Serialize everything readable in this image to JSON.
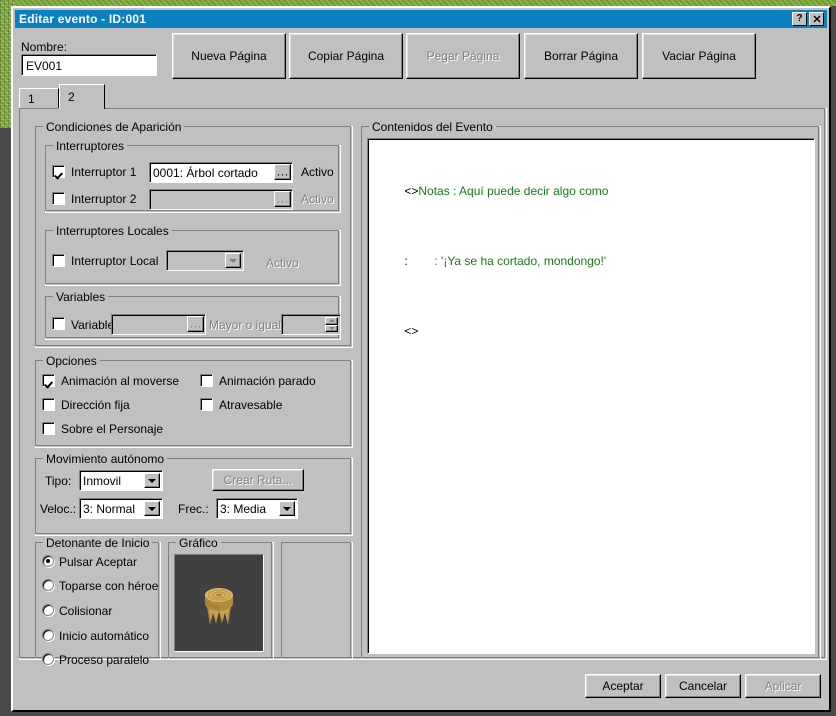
{
  "window": {
    "title": "Editar evento - ID:001",
    "help_button": "?",
    "close_button": "✕"
  },
  "form": {
    "name_label": "Nombre:",
    "name_value": "EV001"
  },
  "page_toolbar": [
    {
      "label": "Nueva Página",
      "enabled": true
    },
    {
      "label": "Copiar Página",
      "enabled": true
    },
    {
      "label": "Pegar Página",
      "enabled": false
    },
    {
      "label": "Borrar Página",
      "enabled": true
    },
    {
      "label": "Vaciar Página",
      "enabled": true
    }
  ],
  "tabs": [
    {
      "label": "1",
      "selected": false
    },
    {
      "label": "2",
      "selected": true
    }
  ],
  "conditions": {
    "title": "Condiciones de Aparición",
    "switches": {
      "title": "Interruptores",
      "rows": [
        {
          "checkbox_label": "Interruptor 1",
          "checked": true,
          "value": "0001: Árbol cortado",
          "browse": "···",
          "state_label": "Activo",
          "enabled": true
        },
        {
          "checkbox_label": "Interruptor 2",
          "checked": false,
          "value": "",
          "browse": "···",
          "state_label": "Activo",
          "enabled": false
        }
      ]
    },
    "local_switches": {
      "title": "Interruptores Locales",
      "checkbox_label": "Interruptor Local",
      "checked": false,
      "value": "",
      "state_label": "Activo",
      "enabled": false
    },
    "variables": {
      "title": "Variables",
      "checkbox_label": "Variable:",
      "checked": false,
      "value": "",
      "browse": "···",
      "operator_label": "Mayor o igual",
      "number_value": "",
      "enabled": false
    }
  },
  "options": {
    "title": "Opciones",
    "items": [
      {
        "label": "Animación al moverse",
        "checked": true
      },
      {
        "label": "Animación parado",
        "checked": false
      },
      {
        "label": "Dirección fija",
        "checked": false
      },
      {
        "label": "Atravesable",
        "checked": false
      },
      {
        "label": "Sobre el Personaje",
        "checked": false
      }
    ]
  },
  "movement": {
    "title": "Movimiento autónomo",
    "type_label": "Tipo:",
    "type_value": "Inmovil",
    "route_button": "Crear Ruta...",
    "route_enabled": false,
    "speed_label": "Veloc.:",
    "speed_value": "3: Normal",
    "freq_label": "Frec.:",
    "freq_value": "3: Media"
  },
  "trigger": {
    "title": "Detonante de Inicio",
    "items": [
      {
        "label": "Pulsar Aceptar",
        "selected": true
      },
      {
        "label": "Toparse con héroe",
        "selected": false
      },
      {
        "label": "Colisionar",
        "selected": false
      },
      {
        "label": "Inicio automático",
        "selected": false
      },
      {
        "label": "Proceso paralelo",
        "selected": false
      }
    ]
  },
  "graphic": {
    "title": "Gráfico",
    "sprite_name": "tree-stump-sprite",
    "background_color": "#404040"
  },
  "event_contents": {
    "title": "Contenidos del Evento",
    "lines": [
      {
        "marker": "<>",
        "text": "Notas : Aquí puede decir algo como",
        "color": "#1a7a1a"
      },
      {
        "marker": ":",
        "text": "        : '¡Ya se ha cortado, mondongo!'",
        "color": "#1a7a1a"
      },
      {
        "marker": "<>",
        "text": "",
        "color": "#1a7a1a"
      }
    ]
  },
  "dialog_buttons": [
    {
      "label": "Aceptar",
      "enabled": true
    },
    {
      "label": "Cancelar",
      "enabled": true
    },
    {
      "label": "Aplicar",
      "enabled": false
    }
  ]
}
